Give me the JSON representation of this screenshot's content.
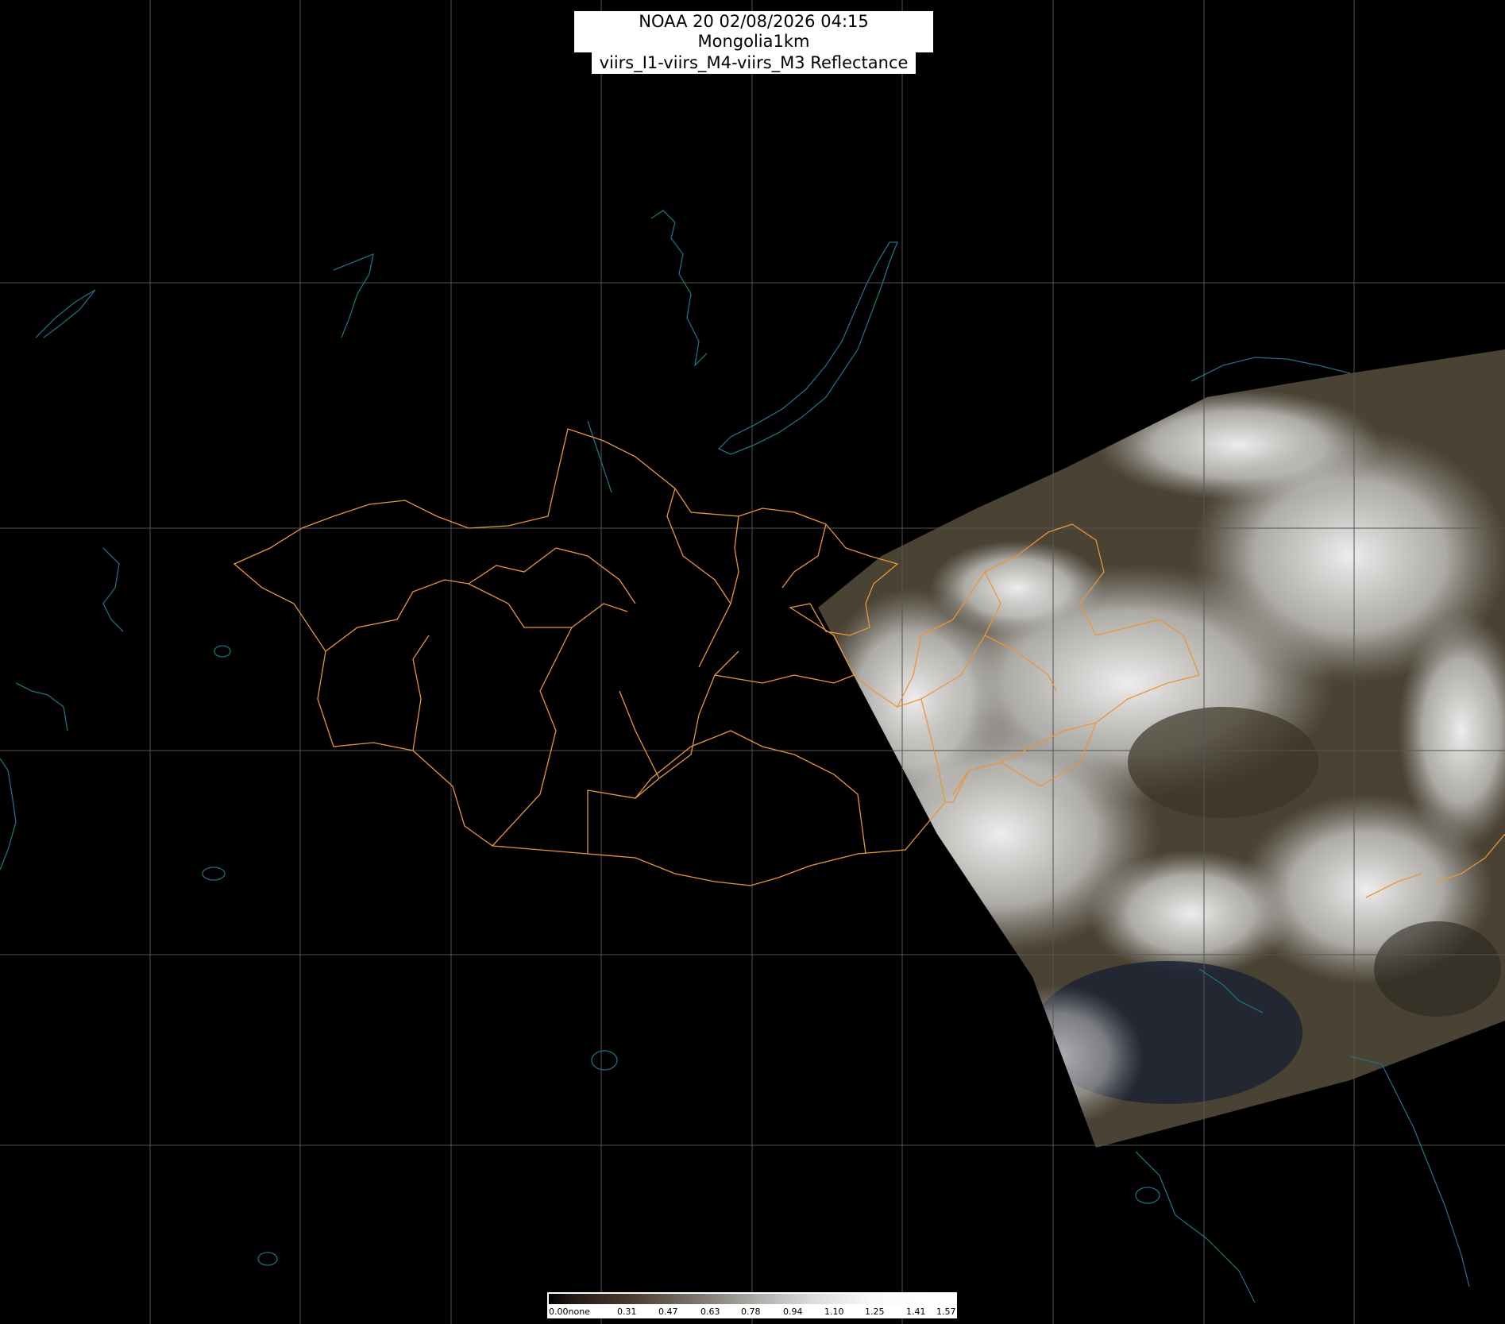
{
  "title": {
    "line1": "NOAA 20 02/08/2026 04:15 Mongolia1km",
    "line2": "viirs_I1-viirs_M4-viirs_M3 Reflectance"
  },
  "colorbar": {
    "ticks": [
      "0.00none",
      "0.31",
      "0.47",
      "0.63",
      "0.78",
      "0.94",
      "1.10",
      "1.25",
      "1.41",
      "1.57"
    ]
  },
  "colors": {
    "background": "#000000",
    "graticule": "#555555",
    "admin_borders": "#e8963a",
    "coastlines": "#1f6f7f",
    "clouds": "#f0f0f0"
  }
}
